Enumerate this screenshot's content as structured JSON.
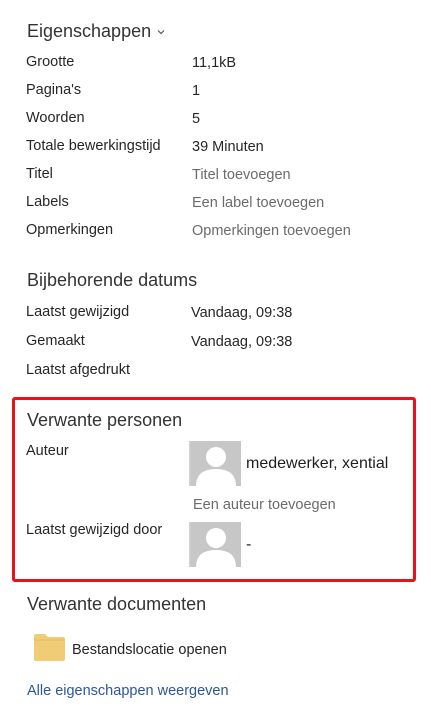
{
  "properties": {
    "title": "Eigenschappen",
    "rows": [
      {
        "label": "Grootte",
        "value": "11,1kB"
      },
      {
        "label": "Pagina's",
        "value": "1"
      },
      {
        "label": "Woorden",
        "value": "5"
      },
      {
        "label": "Totale bewerkingstijd",
        "value": "39 Minuten"
      },
      {
        "label": "Titel",
        "value": "Titel toevoegen"
      },
      {
        "label": "Labels",
        "value": "Een label toevoegen"
      },
      {
        "label": "Opmerkingen",
        "value": "Opmerkingen toevoegen"
      }
    ]
  },
  "dates": {
    "title": "Bijbehorende datums",
    "rows": [
      {
        "label": "Laatst gewijzigd",
        "value": "Vandaag, 09:38"
      },
      {
        "label": "Gemaakt",
        "value": "Vandaag, 09:38"
      },
      {
        "label": "Laatst afgedrukt",
        "value": ""
      }
    ]
  },
  "people": {
    "title": "Verwante personen",
    "author_label": "Auteur",
    "author_name": "medewerker, xential",
    "add_author": "Een auteur toevoegen",
    "last_modified_by_label": "Laatst gewijzigd door",
    "last_modified_by_name": "-"
  },
  "documents": {
    "title": "Verwante documenten",
    "open_location": "Bestandslocatie openen"
  },
  "all_properties_link": "Alle eigenschappen weergeven",
  "colors": {
    "highlight": "#e8121c",
    "link": "#2b5797",
    "folder": "#f0cc76"
  }
}
